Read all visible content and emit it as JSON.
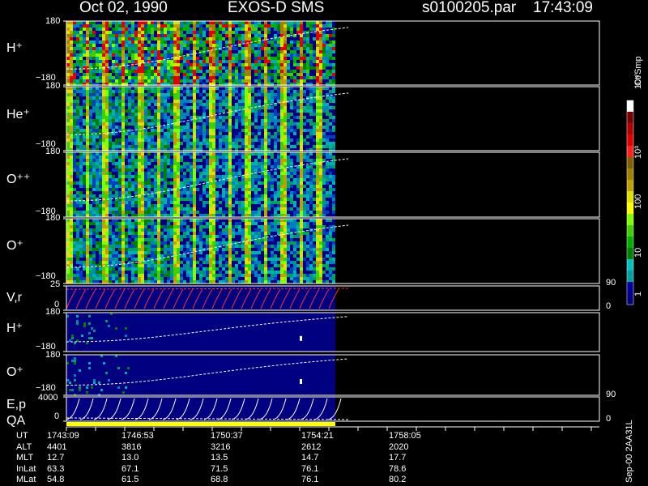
{
  "header": {
    "date": "Oct 02, 1990",
    "mission": "EXOS-D SMS",
    "file": "s0100205.par",
    "time": "17:43:09"
  },
  "panels": [
    {
      "label": "H⁺",
      "top_tick": "180",
      "bottom_tick": "−180"
    },
    {
      "label": "He⁺",
      "top_tick": "180",
      "bottom_tick": "−180"
    },
    {
      "label": "O⁺⁺",
      "top_tick": "180",
      "bottom_tick": "−180"
    },
    {
      "label": "O⁺",
      "top_tick": "180",
      "bottom_tick": "−180"
    },
    {
      "label": "V,r",
      "top_tick": "25",
      "bottom_tick": "0",
      "right_top": "90",
      "right_bottom": "0"
    },
    {
      "label": "H⁺",
      "top_tick": "180",
      "bottom_tick": "−180"
    },
    {
      "label": "O⁺",
      "top_tick": "180",
      "bottom_tick": "−180"
    },
    {
      "label": "E,p",
      "top_tick": "4000",
      "bottom_tick": "0",
      "right_top": "90",
      "right_bottom": "0"
    }
  ],
  "qa_label": "QA",
  "colorbar": {
    "unit": "Ct/Smp",
    "ticks": [
      "10⁴",
      "10³",
      "100",
      "10",
      "1"
    ],
    "colors": [
      "#ffffff",
      "#7a0000",
      "#b00000",
      "#e00000",
      "#ff2020",
      "#806000",
      "#a08000",
      "#c0a000",
      "#e0e000",
      "#ffff00",
      "#80ff00",
      "#40d000",
      "#00b000",
      "#008000",
      "#00c0c0",
      "#00a0a0",
      "#0000a0",
      "#000080"
    ]
  },
  "time_rows": [
    {
      "name": "UT",
      "values": [
        "1743:09",
        "1746:53",
        "1750:37",
        "1754:21",
        "1758:05"
      ]
    },
    {
      "name": "ALT",
      "values": [
        "4401",
        "3816",
        "3216",
        "2612",
        "2020"
      ]
    },
    {
      "name": "MLT",
      "values": [
        "12.7",
        "13.0",
        "13.5",
        "14.7",
        "17.7"
      ]
    },
    {
      "name": "InLat",
      "values": [
        "63.3",
        "67.1",
        "71.5",
        "76.1",
        "78.6"
      ]
    },
    {
      "name": "MLat",
      "values": [
        "54.8",
        "61.5",
        "68.8",
        "76.1",
        "80.2"
      ]
    }
  ],
  "footer_id": "Sep-00 2AA31L",
  "chart_data": {
    "type": "heatmap",
    "title": "Oct 02, 1990  EXOS-D SMS",
    "x": [
      "1743:09",
      "1746:53",
      "1750:37",
      "1754:21",
      "1758:05"
    ],
    "panels": [
      "H⁺",
      "He⁺",
      "O⁺⁺",
      "O⁺",
      "V,r",
      "H⁺",
      "O⁺",
      "E,p"
    ],
    "colorscale_label": "Ct/Smp",
    "colorscale_range": [
      1,
      10000
    ],
    "colorscale_log": true,
    "data_extent": "1743:09–1758:05"
  }
}
